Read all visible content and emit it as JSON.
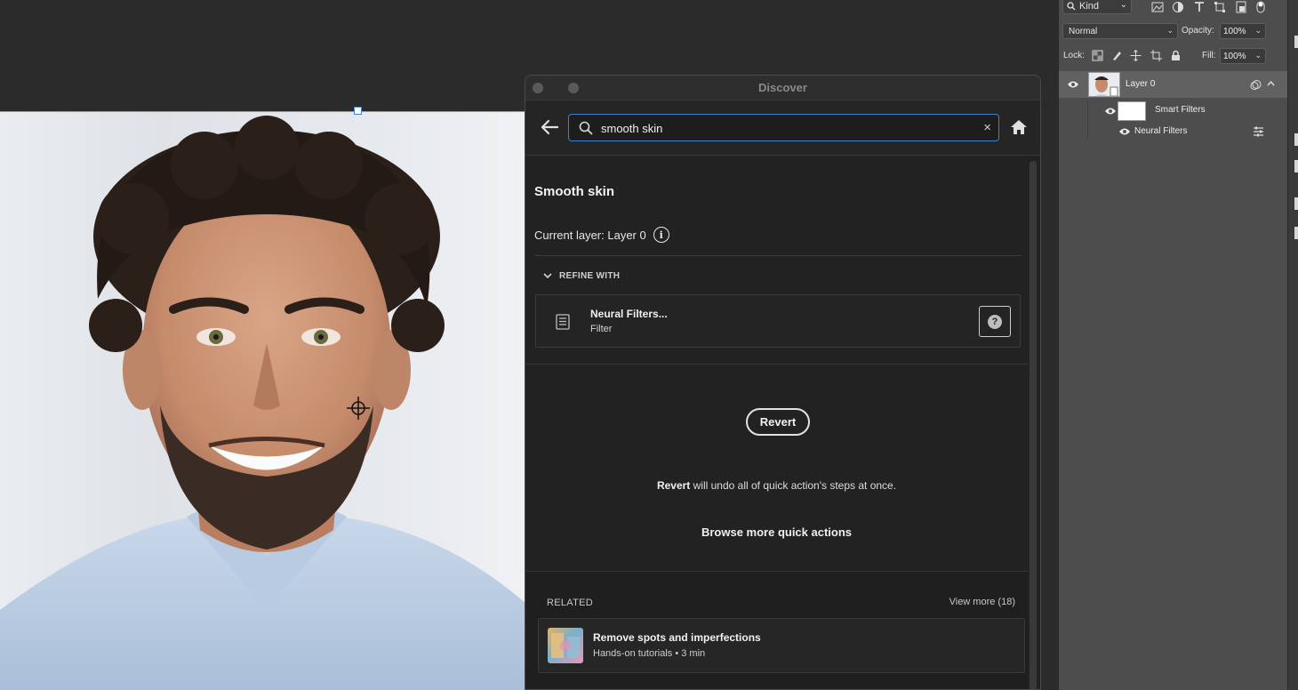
{
  "discover": {
    "window_title": "Discover",
    "search": {
      "value": "smooth skin",
      "clear_glyph": "×"
    },
    "result_title": "Smooth skin",
    "current_layer": "Current layer: Layer 0",
    "info_glyph": "i",
    "refine": {
      "header": "REFINE WITH",
      "item_name": "Neural Filters...",
      "item_type": "Filter",
      "help_glyph": "?"
    },
    "revert": {
      "button_label": "Revert",
      "note_bold": "Revert",
      "note_rest": " will undo all of quick action's steps at once."
    },
    "browse_more": "Browse more quick actions",
    "related": {
      "label": "RELATED",
      "view_more": "View more (18)",
      "items": [
        {
          "title": "Remove spots and imperfections",
          "meta": "Hands-on tutorials  •  3 min"
        }
      ]
    }
  },
  "layers": {
    "kind_filter": "Kind",
    "blend_mode": "Normal",
    "opacity_label": "Opacity:",
    "opacity_value": "100%",
    "lock_label": "Lock:",
    "fill_label": "Fill:",
    "fill_value": "100%",
    "items": [
      {
        "name": "Layer 0"
      },
      {
        "name": "Smart Filters"
      },
      {
        "name": "Neural Filters"
      }
    ]
  },
  "icons": {
    "back": "arrow-left-icon",
    "search": "search-icon",
    "home": "home-icon",
    "chevron": "chevron-down-icon",
    "filter": "filter-icon",
    "eye": "eye-icon"
  },
  "colors": {
    "accent": "#3e7fd6",
    "panel_bg": "#222222",
    "layers_bg": "#4d4d4d",
    "selected_layer": "#616161"
  }
}
